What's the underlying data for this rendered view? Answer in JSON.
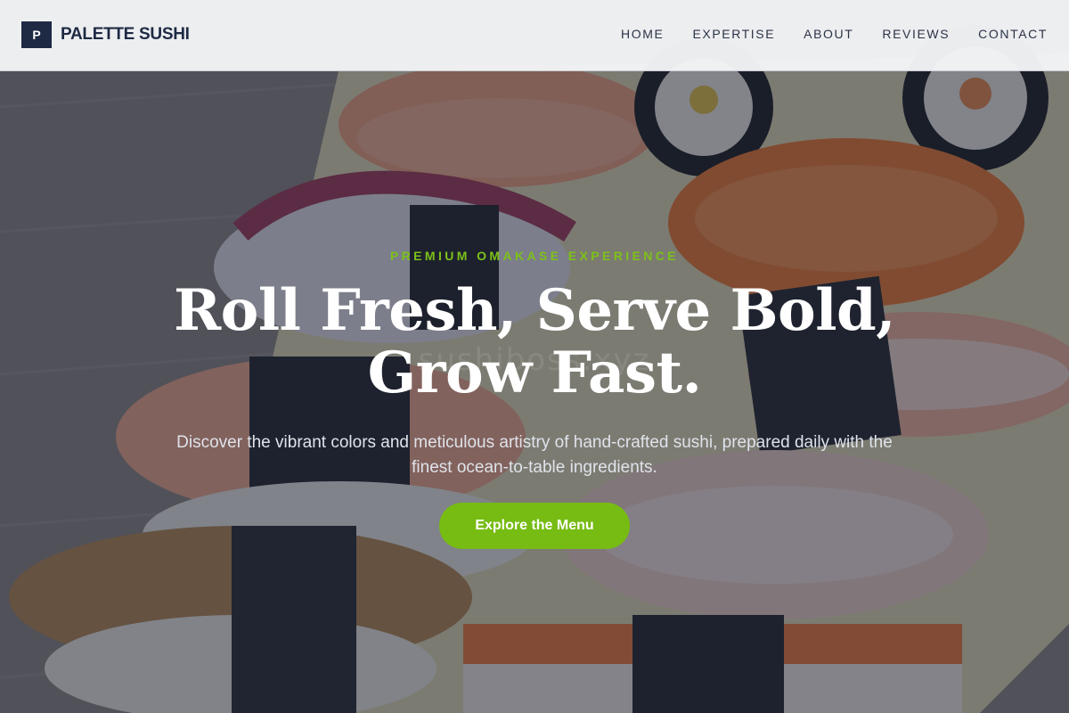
{
  "header": {
    "logo_letter": "P",
    "brand_name": "PALETTE SUSHI",
    "nav": [
      {
        "label": "HOME"
      },
      {
        "label": "EXPERTISE"
      },
      {
        "label": "ABOUT"
      },
      {
        "label": "REVIEWS"
      },
      {
        "label": "CONTACT"
      }
    ]
  },
  "hero": {
    "eyebrow": "PREMIUM OMAKASE EXPERIENCE",
    "headline_line1": "Roll Fresh, Serve Bold,",
    "headline_line2": "Grow Fast.",
    "subtitle": "Discover the vibrant colors and meticulous artistry of hand-crafted sushi, prepared daily with the finest ocean-to-table ingredients.",
    "cta_label": "Explore the Menu",
    "watermark": "sushiboss.xyz"
  },
  "colors": {
    "accent": "#76bc13",
    "eyebrow": "#7cc11a",
    "brand_dark": "#1e2a44",
    "overlay": "#182034"
  },
  "icons": {
    "hero_image": "sushi-platter-photo"
  }
}
